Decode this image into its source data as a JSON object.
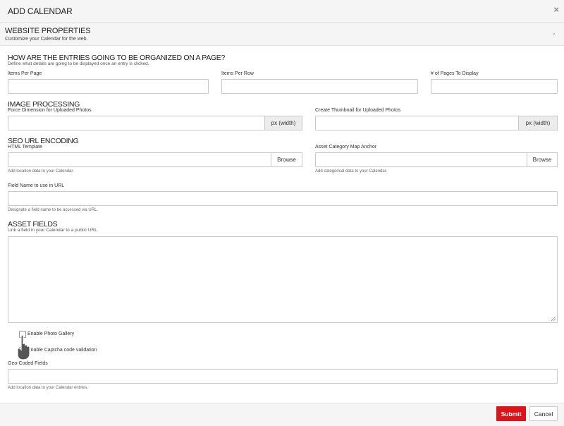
{
  "dialog": {
    "title": "ADD CALENDAR",
    "close_glyph": "×"
  },
  "website_properties": {
    "title": "WEBSITE PROPERTIES",
    "subtitle": "Customize your Calendar for the web.",
    "chevron_glyph": "⌄"
  },
  "organization": {
    "heading": "HOW ARE THE ENTRIES GOING TO BE ORGANIZED ON A PAGE?",
    "subtitle": "Define what details are going to be displayed once an entry is clicked.",
    "items_per_page_label": "Items Per Page",
    "items_per_page_value": "",
    "items_per_row_label": "Items Per Row",
    "items_per_row_value": "",
    "pages_to_display_label": "# of Pages To Display",
    "pages_to_display_value": ""
  },
  "image_processing": {
    "heading": "IMAGE PROCESSING",
    "force_dimension_label": "Force Dimension for Uploaded Photos",
    "force_dimension_value": "",
    "force_dimension_addon": "px (width)",
    "thumbnail_label": "Create Thumbnail for Uploaded Photos",
    "thumbnail_value": "",
    "thumbnail_addon": "px (width)"
  },
  "seo": {
    "heading": "SEO URL ENCODING",
    "html_template_label": "HTML Template",
    "html_template_value": "",
    "html_template_browse": "Browse",
    "html_template_help": "Add location data to your Calendar.",
    "asset_anchor_label": "Asset Category Map Anchor",
    "asset_anchor_value": "",
    "asset_anchor_browse": "Browse",
    "asset_anchor_help": "Add categorical data to your Calendar.",
    "field_name_label": "Field Name to use in URL",
    "field_name_value": "",
    "field_name_help": "Designate a field name to be accessed via URL."
  },
  "asset_fields": {
    "heading": "ASSET FIELDS",
    "subtitle": "Link a field in your Calendar to a public URL.",
    "value": ""
  },
  "options": {
    "photo_gallery_label": "Enable Photo Gallery",
    "photo_gallery_checked": false,
    "captcha_label": "Enable Captcha code validation",
    "captcha_checked": false
  },
  "geo": {
    "label": "Geo-Coded Fields",
    "value": "",
    "help": "Add location data to your Calendar entries."
  },
  "footer": {
    "submit_label": "Submit",
    "cancel_label": "Cancel"
  },
  "colors": {
    "accent": "#d9141a",
    "header_bg": "#f5f5f5",
    "border": "#c9c9c9"
  },
  "icons": {
    "close": "close-icon",
    "chevron": "chevron-down-icon",
    "cursor": "hand-pointer-cursor-icon"
  }
}
